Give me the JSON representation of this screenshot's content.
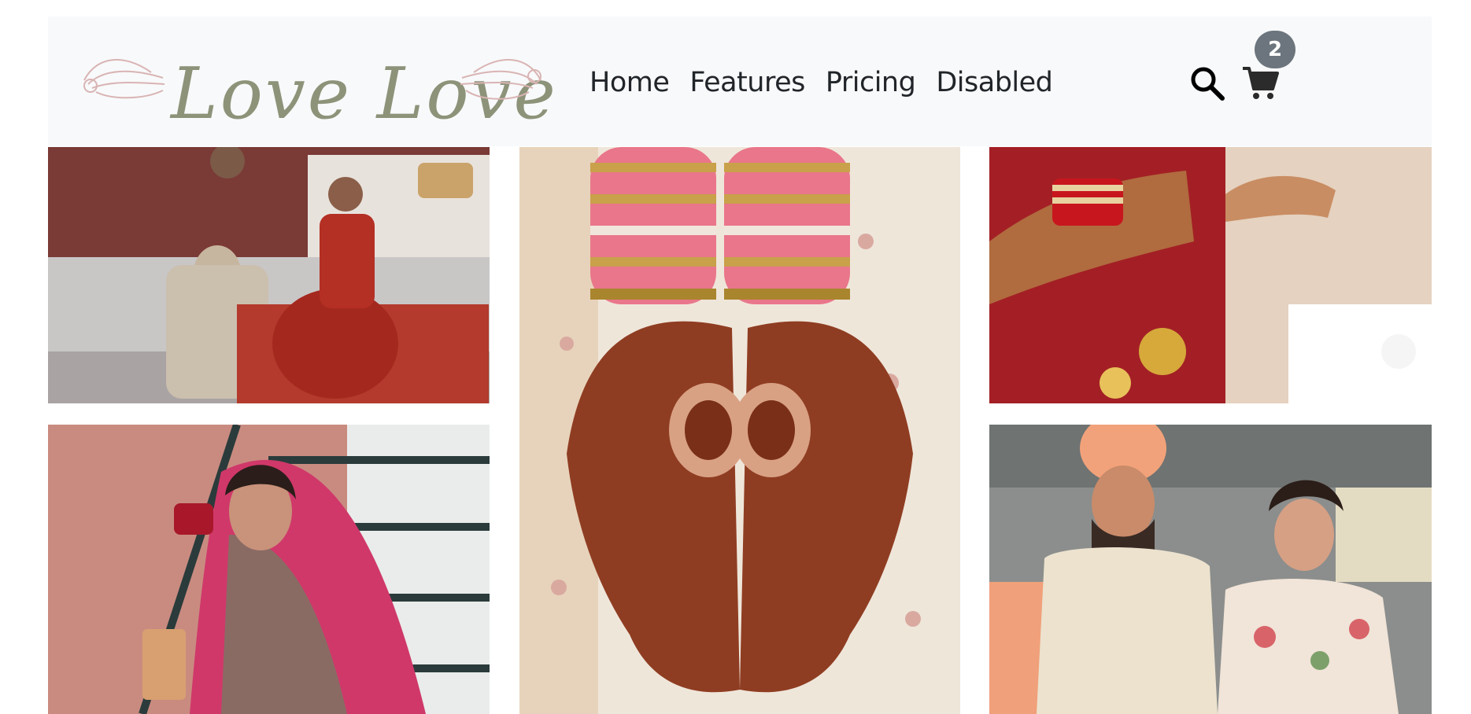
{
  "brand": {
    "name": "Love Love"
  },
  "nav": {
    "items": [
      {
        "label": "Home"
      },
      {
        "label": "Features"
      },
      {
        "label": "Pricing"
      },
      {
        "label": "Disabled"
      }
    ]
  },
  "cart": {
    "count": "2"
  },
  "gallery": {
    "photos": [
      {
        "subject": "couple-seated"
      },
      {
        "subject": "henna-hands-bangles"
      },
      {
        "subject": "ceremony-hands"
      },
      {
        "subject": "bride-on-stairs"
      },
      {
        "subject": "couple-standing"
      }
    ]
  },
  "colors": {
    "navbar_bg": "#f8f9fa",
    "logo": "#8c9379",
    "ornament": "#d9b4b4",
    "badge": "#6c757d"
  }
}
